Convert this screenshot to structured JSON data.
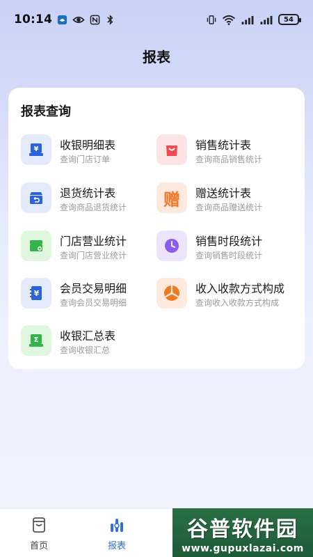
{
  "status_bar": {
    "time": "10:14",
    "battery": "54"
  },
  "header": {
    "title": "报表"
  },
  "card": {
    "title": "报表查询",
    "items": [
      {
        "title": "收银明细表",
        "subtitle": "查询门店订单",
        "icon": "cash-register-icon",
        "icon_bg": "#e3ebfb",
        "icon_color": "#2a63dc"
      },
      {
        "title": "销售统计表",
        "subtitle": "查询商品销售统计",
        "icon": "shopping-bag-icon",
        "icon_bg": "#fde4e4",
        "icon_color": "#f0494f"
      },
      {
        "title": "退货统计表",
        "subtitle": "查询商品退货统计",
        "icon": "return-box-icon",
        "icon_bg": "#e3ebfb",
        "icon_color": "#2a63dc"
      },
      {
        "title": "赠送统计表",
        "subtitle": "查询商品赠送统计",
        "icon": "gift-icon",
        "icon_bg": "#fde9dd",
        "icon_color": "#f07a2e",
        "icon_char": "赠"
      },
      {
        "title": "门店营业统计",
        "subtitle": "查询门店营业统计",
        "icon": "store-icon",
        "icon_bg": "#dff6df",
        "icon_color": "#33b34a"
      },
      {
        "title": "销售时段统计",
        "subtitle": "查询销售时段统计",
        "icon": "clock-icon",
        "icon_bg": "#ebe4fb",
        "icon_color": "#8a5cf0"
      },
      {
        "title": "会员交易明细",
        "subtitle": "查询会员交易明细",
        "icon": "member-book-icon",
        "icon_bg": "#e3ebfb",
        "icon_color": "#2a63dc"
      },
      {
        "title": "收入收款方式构成",
        "subtitle": "查询收入收款方式构成",
        "icon": "pie-chart-icon",
        "icon_bg": "#fde9dd",
        "icon_color": "#ef7a22"
      },
      {
        "title": "收银汇总表",
        "subtitle": "查询收银汇总",
        "icon": "summary-icon",
        "icon_bg": "#dff6df",
        "icon_color": "#33b34a"
      }
    ]
  },
  "tabbar": {
    "tabs": [
      {
        "label": "首页",
        "icon": "home-icon",
        "active": false
      },
      {
        "label": "报表",
        "icon": "report-icon",
        "active": true
      }
    ]
  },
  "watermark": {
    "main": "谷普软件园",
    "sub": "www.gupuxlazai.com"
  },
  "colors": {
    "accent": "#2f6fde"
  }
}
